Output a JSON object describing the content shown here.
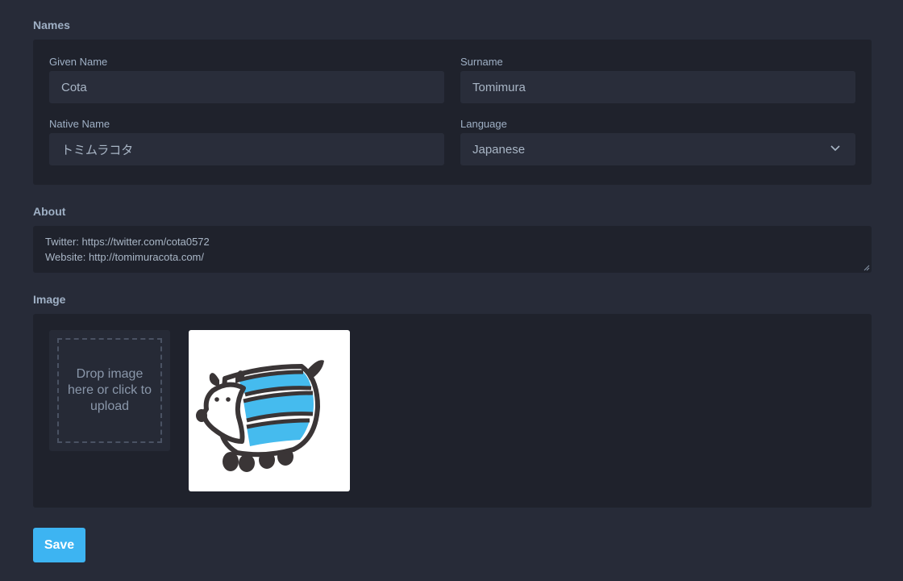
{
  "names": {
    "title": "Names",
    "given_name": {
      "label": "Given Name",
      "value": "Cota"
    },
    "surname": {
      "label": "Surname",
      "value": "Tomimura"
    },
    "native_name": {
      "label": "Native Name",
      "value": "トミムラコタ"
    },
    "language": {
      "label": "Language",
      "value": "Japanese"
    }
  },
  "about": {
    "title": "About",
    "line1": "Twitter: https://twitter.com/cota0572",
    "line2": "Website: http://tomimuracota.com/"
  },
  "image": {
    "title": "Image",
    "dropzone_text": "Drop image here or click to upload"
  },
  "save_label": "Save",
  "colors": {
    "background": "#272b38",
    "panel": "#1f222c",
    "field": "#292d3a",
    "accent": "#3db4f2"
  }
}
